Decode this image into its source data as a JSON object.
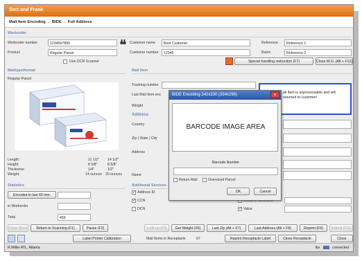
{
  "app": {
    "title": "Sort and Frank"
  },
  "breadcrumb": {
    "text": "Mail Item Encoding  →  BIDE  →  Full Address"
  },
  "workorder": {
    "section": "Workorder",
    "number_label": "Workorder number",
    "number_value": "1234567890",
    "customer_name_label": "Customer name",
    "customer_name_value": "Best Customer",
    "reference_label": "Reference",
    "reference_value": "Reference 1",
    "product_label": "Product",
    "product_value": "Regular Parcel",
    "customer_number_label": "Customer number",
    "customer_number_value": "12345",
    "batch_label": "Batch",
    "batch_value": "Reference 2",
    "ocr_label": "Use OCR Scanner",
    "special_btn": "Special handling instruction (F7)",
    "close_wo_btn": "Close W.O. (Alt + F12)"
  },
  "mailtype": {
    "section": "Mailtype/format",
    "name": "Regular Parcel",
    "length_label": "Length:",
    "length_v1": "11 1/2\"",
    "length_v2": "14 1/2\"",
    "height_label": "Height:",
    "height_v1": "8 5/8\"",
    "height_v2": "8 5/8\"",
    "thickness_label": "Thickness:",
    "thickness_v1": "1/4\"",
    "thickness_v2": "1/2\"",
    "weight_label": "Weight:",
    "weight_v1": "14 ounces",
    "weight_v2": "20 ounces"
  },
  "statistics": {
    "section": "Statistics",
    "encoded_btn": "Encoded in last 60 min.",
    "in_wo_label": "in Workorder",
    "total_label": "Total",
    "total_value": "459"
  },
  "mailitem": {
    "section": "Mail Item",
    "tracking_label": "Tracking number",
    "last_label": "Last Mail Item enc",
    "weight_label": "Weight",
    "address_header": "Address",
    "country_label": "Country",
    "zip_label": "Zip | State | City",
    "address_label": "Address",
    "name_label": "Name"
  },
  "notice": {
    "text": "ail Item is unprocessable and will returned to customer!"
  },
  "additional": {
    "section": "Additional Services",
    "address_id": "Address ID",
    "ccn": "CCN",
    "dcn": "DCN",
    "content_assurance": "Content Assurance",
    "value": "Value"
  },
  "dialog": {
    "title": "BIDE Encoding 342x330 (334x296)",
    "image_area": "BARCODE IMAGE AREA",
    "barcode_label": "Barcode Number",
    "return_mail": "Return Mail",
    "oversized": "Oversized Parcel",
    "ok": "OK",
    "cancel": "Cancel"
  },
  "bottom_row1": {
    "clear": "Clear (Esc)",
    "return_scan": "Return to Scanning (F1)",
    "pause": "Pause (F2)",
    "lookup": "Look up (F5)",
    "get_weight": "Get Weight (F6)",
    "last_zip": "Last Zip (Alt + F7)",
    "last_address": "Last Address (Alt + F8)",
    "reprint": "Reprint (F9)",
    "submit": "Submit (F11)"
  },
  "bottom_row2": {
    "label_printer": "Label Printer Calibration",
    "receptacle_label": "Mail Items in Receptacle",
    "receptacle_value": "67",
    "reprint_receptacle": "Reprint Receptacle Label",
    "close_receptacle": "Close Receptacle",
    "close": "Close"
  },
  "status": {
    "user": "R.Miller ATL, Atlanta",
    "right": "lbs",
    "connection": "connected"
  },
  "colors": {
    "title": "#e07a1f",
    "section": "#6e86b4",
    "notice_border": "#2f4fd0",
    "dialog_title": "#3b68b8"
  }
}
